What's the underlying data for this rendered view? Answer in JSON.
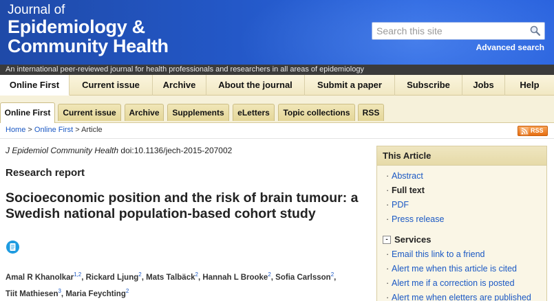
{
  "header": {
    "logo_line1": "Journal of",
    "logo_line2": "Epidemiology &",
    "logo_line3": "Community Health",
    "search_placeholder": "Search this site",
    "advanced_search": "Advanced search",
    "tagline": "An international peer-reviewed journal for health professionals and researchers in all areas of epidemiology"
  },
  "primary_nav": [
    {
      "label": "Online First",
      "active": true
    },
    {
      "label": "Current issue"
    },
    {
      "label": "Archive"
    },
    {
      "label": "About the journal"
    },
    {
      "label": "Submit a paper"
    },
    {
      "label": "Subscribe"
    },
    {
      "label": "Jobs"
    },
    {
      "label": "Help"
    }
  ],
  "secondary_nav": [
    {
      "label": "Online First",
      "active": true
    },
    {
      "label": "Current issue"
    },
    {
      "label": "Archive"
    },
    {
      "label": "Supplements"
    },
    {
      "label": "eLetters"
    },
    {
      "label": "Topic collections"
    },
    {
      "label": "RSS"
    }
  ],
  "breadcrumb": {
    "home": "Home",
    "sep1": " > ",
    "online_first": "Online First",
    "sep2": " > ",
    "current": "Article"
  },
  "rss_badge": "RSS",
  "article": {
    "journal": "J Epidemiol Community Health",
    "doi": " doi:10.1136/jech-2015-207002",
    "type": "Research report",
    "title": "Socioeconomic position and the risk of brain tumour: a Swedish national population-based cohort study",
    "authors": [
      {
        "name": "Amal R Khanolkar",
        "sup": "1,2"
      },
      {
        "name": "Rickard Ljung",
        "sup": "2"
      },
      {
        "name": "Mats Talbäck",
        "sup": "2"
      },
      {
        "name": "Hannah L Brooke",
        "sup": "2"
      },
      {
        "name": "Sofia Carlsson",
        "sup": "2"
      },
      {
        "name": "Tiit Mathiesen",
        "sup": "3"
      },
      {
        "name": "Maria Feychting",
        "sup": "2"
      }
    ]
  },
  "this_article": {
    "title": "This Article",
    "links": [
      {
        "label": "Abstract"
      },
      {
        "label": "Full text",
        "current": true
      },
      {
        "label": "PDF"
      },
      {
        "label": "Press release"
      }
    ],
    "services_title": "Services",
    "collapse_symbol": "-",
    "services": [
      {
        "label": "Email this link to a friend"
      },
      {
        "label": "Alert me when this article is cited"
      },
      {
        "label": "Alert me if a correction is posted"
      },
      {
        "label": "Alert me when eletters are published"
      }
    ]
  }
}
